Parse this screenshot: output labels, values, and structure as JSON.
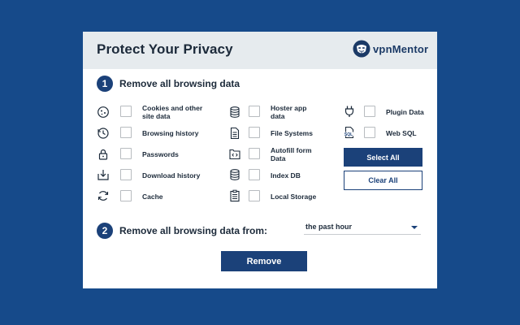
{
  "header": {
    "title": "Protect Your Privacy",
    "logo_text_a": "vpn",
    "logo_text_b": "Mentor"
  },
  "section1": {
    "number": "1",
    "heading": "Remove all browsing data"
  },
  "col1": [
    {
      "label_line1": "Cookies and other",
      "label_line2": "site data",
      "icon": "cookie-icon",
      "checked": false
    },
    {
      "label_line1": "Browsing history",
      "label_line2": "",
      "icon": "history-icon",
      "checked": false
    },
    {
      "label_line1": "Passwords",
      "label_line2": "",
      "icon": "lock-icon",
      "checked": false
    },
    {
      "label_line1": "Download history",
      "label_line2": "",
      "icon": "download-icon",
      "checked": false
    },
    {
      "label_line1": "Cache",
      "label_line2": "",
      "icon": "refresh-icon",
      "checked": false
    }
  ],
  "col2": [
    {
      "label_line1": "Hoster app",
      "label_line2": "data",
      "icon": "database-icon",
      "checked": false
    },
    {
      "label_line1": "File Systems",
      "label_line2": "",
      "icon": "file-icon",
      "checked": false
    },
    {
      "label_line1": "Autofill form",
      "label_line2": "Data",
      "icon": "form-code-icon",
      "checked": false
    },
    {
      "label_line1": "Index DB",
      "label_line2": "",
      "icon": "database-icon",
      "checked": false
    },
    {
      "label_line1": "Local Storage",
      "label_line2": "",
      "icon": "storage-list-icon",
      "checked": false
    }
  ],
  "col3": [
    {
      "label_line1": "Plugin Data",
      "label_line2": "",
      "icon": "plug-icon",
      "checked": false
    },
    {
      "label_line1": "Web SQL",
      "label_line2": "",
      "icon": "sql-file-icon",
      "checked": false
    }
  ],
  "buttons": {
    "select_all": "Select All",
    "clear_all": "Clear All",
    "remove": "Remove"
  },
  "section2": {
    "number": "2",
    "heading": "Remove all browsing data from:",
    "selected_range": "the past hour"
  },
  "colors": {
    "background": "#164a8a",
    "accent": "#1b4179",
    "header_bg": "#e6ebee"
  }
}
